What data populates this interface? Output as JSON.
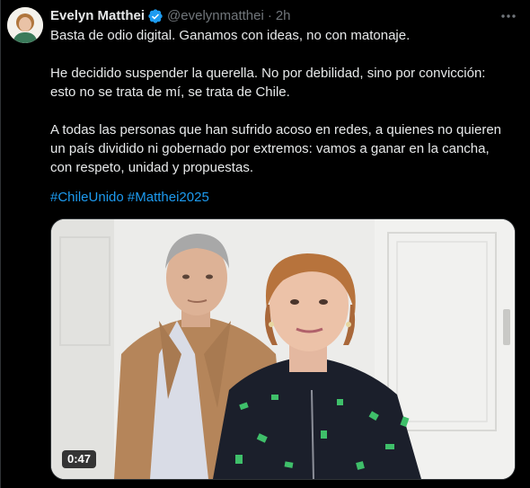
{
  "author": {
    "display_name": "Evelyn Matthei",
    "handle": "@evelynmatthei",
    "separator": "·",
    "time": "2h",
    "avatar": "avatar",
    "verified_icon": "verified-badge-icon"
  },
  "tweet": {
    "paragraphs": [
      "Basta de odio digital. Ganamos con ideas, no con matonaje.",
      "He decidido suspender la querella. No por debilidad, sino por convicción:",
      "esto no se trata de mí, se trata de Chile.",
      "A todas las personas que han sufrido acoso en redes, a quienes no quieren",
      "un país dividido ni gobernado por extremos: vamos a ganar en la cancha,",
      "con respeto, unidad y propuestas."
    ],
    "hashtags": [
      "#ChileUnido",
      "#Matthei2025"
    ]
  },
  "media": {
    "type": "video",
    "duration": "0:47"
  },
  "colors": {
    "background": "#000000",
    "text": "#e7e9ea",
    "muted": "#71767b",
    "link": "#1d9bf0",
    "verified": "#1d9bf0"
  }
}
